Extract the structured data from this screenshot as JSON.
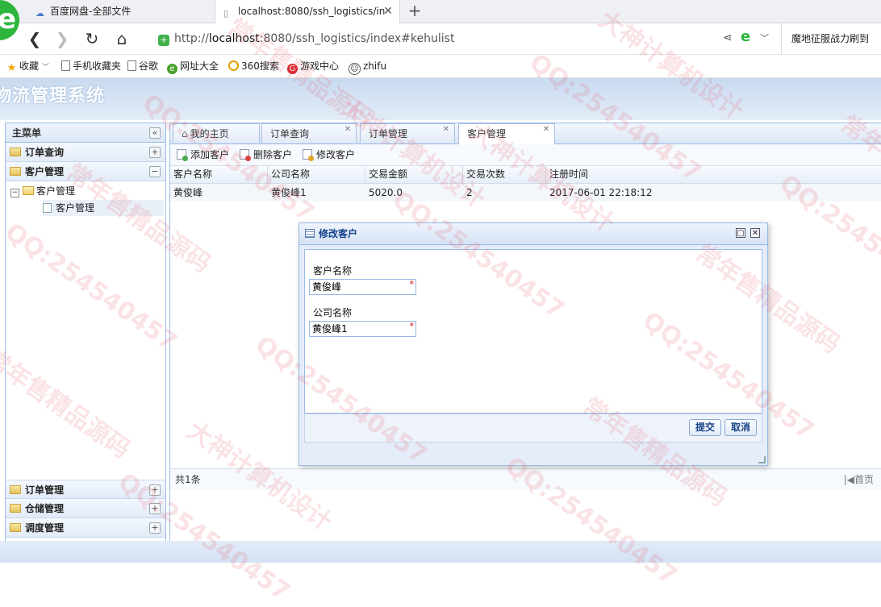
{
  "browser": {
    "tabs": [
      {
        "title": "百度网盘-全部文件"
      },
      {
        "title": "localhost:8080/ssh_logistics/in"
      }
    ],
    "url_prefix": "http://",
    "url_host": "localhost",
    "url_rest": ":8080/ssh_logistics/index#kehulist",
    "news": "魔地征服战力刷到",
    "bookmarks": [
      "收藏",
      "手机收藏夹",
      "谷歌",
      "网址大全",
      "360搜索",
      "游戏中心",
      "zhifu"
    ]
  },
  "app": {
    "title": "物流管理系统",
    "menu_title": "主菜单",
    "accordion": [
      {
        "label": "订单查询"
      },
      {
        "label": "客户管理"
      },
      {
        "label": "订单管理"
      },
      {
        "label": "仓储管理"
      },
      {
        "label": "调度管理"
      }
    ],
    "tree": {
      "parent": "客户管理",
      "child": "客户管理"
    }
  },
  "tabs": [
    {
      "label": "我的主页"
    },
    {
      "label": "订单查询"
    },
    {
      "label": "订单管理"
    },
    {
      "label": "客户管理"
    }
  ],
  "toolbar": {
    "add": "添加客户",
    "delete": "删除客户",
    "edit": "修改客户"
  },
  "grid": {
    "columns": [
      "客户名称",
      "公司名称",
      "交易金额",
      "交易次数",
      "注册时间"
    ],
    "rows": [
      [
        "黄俊峰",
        "黄俊峰1",
        "5020.0",
        "2",
        "2017-06-01 22:18:12"
      ]
    ]
  },
  "pager": {
    "total": "共1条",
    "first": "首页"
  },
  "dialog": {
    "title": "修改客户",
    "fields": [
      {
        "label": "客户名称",
        "value": "黄俊峰"
      },
      {
        "label": "公司名称",
        "value": "黄俊峰1"
      }
    ],
    "submit": "提交",
    "cancel": "取消"
  },
  "watermark": {
    "lines": [
      "QQ:254540457",
      "大神计算机设计",
      "常年售精品源码"
    ]
  }
}
